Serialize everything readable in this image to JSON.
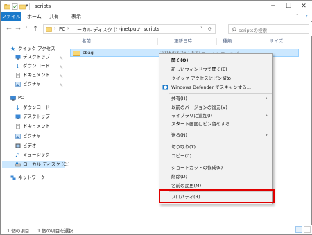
{
  "window": {
    "title": "scripts",
    "controls": {
      "minimize": "─",
      "maximize": "☐",
      "close": "✕"
    }
  },
  "ribbon": {
    "tabs": [
      "ファイル",
      "ホーム",
      "共有",
      "表示"
    ],
    "expand": "˅",
    "help": "?"
  },
  "address": {
    "back": "←",
    "forward": "→",
    "recent": "˅",
    "up": "↑",
    "crumbs": [
      "PC",
      "ローカル ディスク (C:)",
      "inetpub",
      "scripts"
    ],
    "separator": "›",
    "dropdown": "˅",
    "refresh": "⟳",
    "search_placeholder": "scriptsの検索"
  },
  "nav": {
    "items": [
      {
        "label": "クイック アクセス",
        "icon": "star-icon",
        "pinned": false
      },
      {
        "label": "デスクトップ",
        "icon": "desktop-icon",
        "pinned": true
      },
      {
        "label": "ダウンロード",
        "icon": "download-icon",
        "pinned": true
      },
      {
        "label": "ドキュメント",
        "icon": "document-icon",
        "pinned": true
      },
      {
        "label": "ピクチャ",
        "icon": "picture-icon",
        "pinned": true
      },
      {
        "label": "PC",
        "icon": "pc-icon",
        "pinned": false
      },
      {
        "label": "ダウンロード",
        "icon": "download-icon",
        "pinned": false
      },
      {
        "label": "デスクトップ",
        "icon": "desktop-icon",
        "pinned": false
      },
      {
        "label": "ドキュメント",
        "icon": "document-icon",
        "pinned": false
      },
      {
        "label": "ピクチャ",
        "icon": "picture-icon",
        "pinned": false
      },
      {
        "label": "ビデオ",
        "icon": "video-icon",
        "pinned": false
      },
      {
        "label": "ミュージック",
        "icon": "music-icon",
        "pinned": false
      },
      {
        "label": "ローカル ディスク (C:)",
        "icon": "drive-icon",
        "pinned": false,
        "selected": true
      },
      {
        "label": "ネットワーク",
        "icon": "network-icon",
        "pinned": false
      }
    ],
    "pin_glyph": "✎"
  },
  "columns": [
    "名前",
    "更新日時",
    "種類",
    "サイズ"
  ],
  "files": [
    {
      "name": "cbag",
      "date": "2016/03/26 12:22",
      "type": "ファイル フォルダー"
    }
  ],
  "context_menu": {
    "items": [
      "開く(O)",
      "新しいウィンドウで開く(E)",
      "クイック アクセスにピン留め",
      "Windows Defender でスキャンする...",
      "共有(H)",
      "以前のバージョンの復元(V)",
      "ライブラリに追加(I)",
      "スタート画面にピン留めする",
      "送る(N)",
      "切り取り(T)",
      "コピー(C)",
      "ショートカットの作成(S)",
      "削除(D)",
      "名前の変更(M)",
      "プロパティ(R)"
    ],
    "submenu_arrow": "›"
  },
  "status": {
    "count": "1 個の項目",
    "selected": "1 個の項目を選択"
  },
  "colors": {
    "accent": "#1979ca",
    "selection": "#cce8ff",
    "highlight_box": "#e00000"
  }
}
